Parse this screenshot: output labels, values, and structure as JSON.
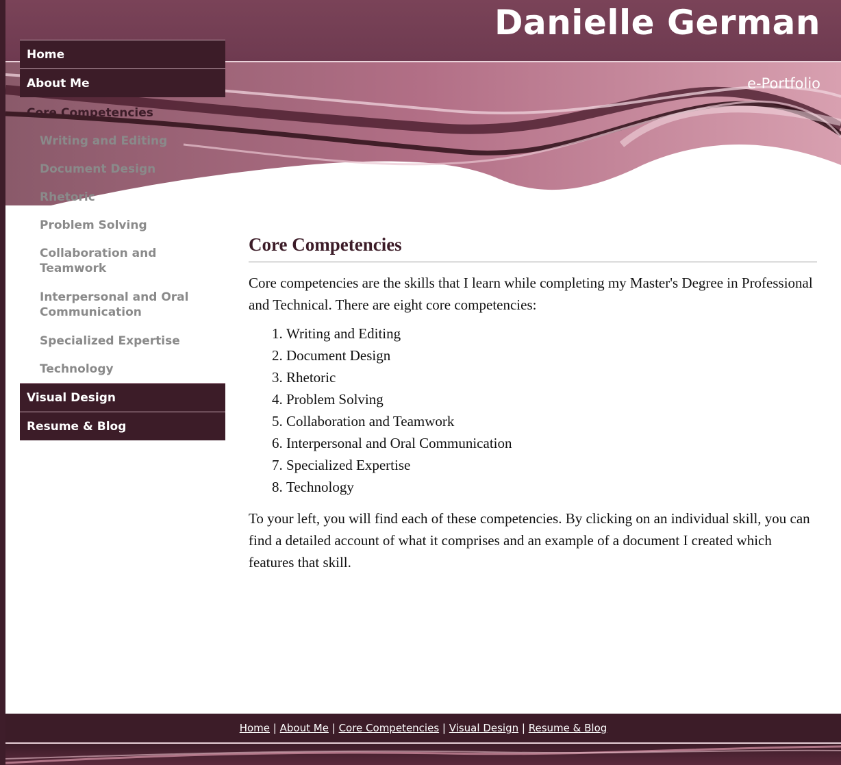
{
  "site": {
    "title": "Danielle German",
    "subtitle": "e-Portfolio"
  },
  "nav": {
    "home": "Home",
    "about": "About Me",
    "core": "Core Competencies",
    "subs": [
      "Writing and Editing",
      "Document Design",
      "Rhetoric",
      "Problem Solving",
      "Collaboration and Teamwork",
      "Interpersonal and Oral Communication",
      "Specialized Expertise",
      "Technology"
    ],
    "visual": "Visual Design",
    "resume": "Resume & Blog"
  },
  "content": {
    "heading": "Core Competencies",
    "intro": "Core competencies are the skills that I learn while completing my Master's Degree in Professional and Technical.  There are eight core competencies:",
    "list": [
      "Writing and Editing",
      "Document Design",
      "Rhetoric",
      "Problem Solving",
      "Collaboration and Teamwork",
      "Interpersonal and Oral Communication",
      "Specialized Expertise",
      "Technology"
    ],
    "outro": "To your left, you will find each of these competencies.  By clicking on an individual skill, you can find a detailed account of what it comprises and an example of a document I created which features that skill."
  },
  "footer": {
    "links": [
      "Home",
      "About Me",
      "Core Competencies",
      "Visual Design",
      "Resume & Blog"
    ],
    "separator": "|"
  },
  "colors": {
    "accent": "#3c1c28",
    "header": "#7a4358",
    "subnav": "#8a8a8a",
    "ribbon": "#c98a9c"
  }
}
